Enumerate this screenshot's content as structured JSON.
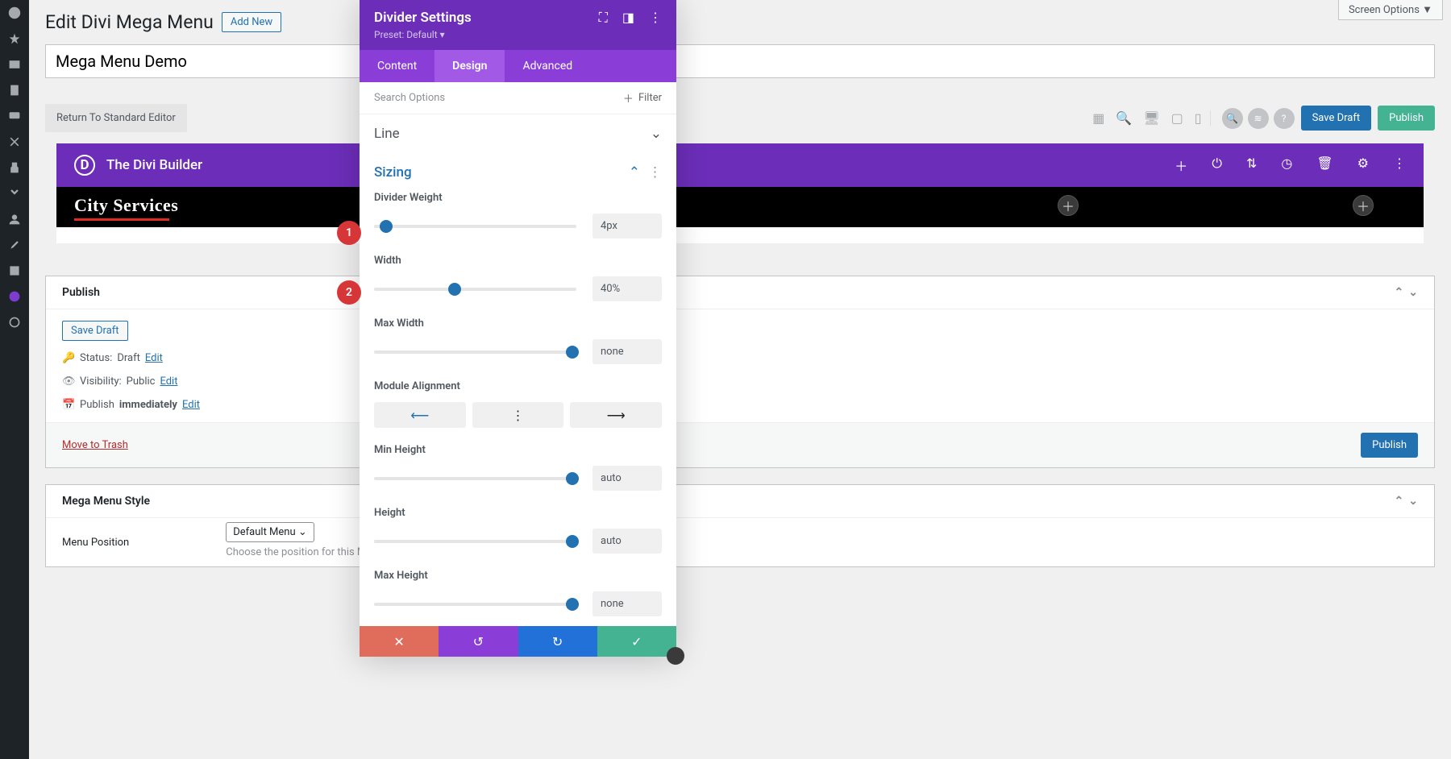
{
  "screen_options": "Screen Options ▼",
  "page_title": "Edit Divi Mega Menu",
  "add_new": "Add New",
  "post_title": "Mega Menu Demo",
  "return_editor": "Return To Standard Editor",
  "toolbar": {
    "save_draft": "Save Draft",
    "publish": "Publish"
  },
  "divi_bar": {
    "title": "The Divi Builder"
  },
  "city": {
    "title": "City Services"
  },
  "publish_box": {
    "heading": "Publish",
    "save_draft": "Save Draft",
    "status_label": "Status:",
    "status_value": "Draft",
    "edit": "Edit",
    "visibility_label": "Visibility:",
    "visibility_value": "Public",
    "visibility_edit": "Edit",
    "schedule_label": "Publish",
    "schedule_value": "immediately",
    "schedule_edit": "Edit",
    "trash": "Move to Trash",
    "publish": "Publish"
  },
  "style_box": {
    "heading": "Mega Menu Style",
    "position_label": "Menu Position",
    "position_value": "Default Menu ⌄",
    "position_help": "Choose the position for this Mega."
  },
  "panel": {
    "title": "Divider Settings",
    "preset": "Preset: Default ▾",
    "tabs": {
      "content": "Content",
      "design": "Design",
      "advanced": "Advanced"
    },
    "search_placeholder": "Search Options",
    "filter": "Filter",
    "sections": {
      "line": "Line",
      "sizing": "Sizing"
    },
    "fields": {
      "weight_label": "Divider Weight",
      "weight_value": "4px",
      "width_label": "Width",
      "width_value": "40%",
      "maxwidth_label": "Max Width",
      "maxwidth_value": "none",
      "alignment_label": "Module Alignment",
      "minheight_label": "Min Height",
      "minheight_value": "auto",
      "height_label": "Height",
      "height_value": "auto",
      "maxheight_label": "Max Height",
      "maxheight_value": "none"
    }
  },
  "badges": {
    "one": "1",
    "two": "2"
  }
}
